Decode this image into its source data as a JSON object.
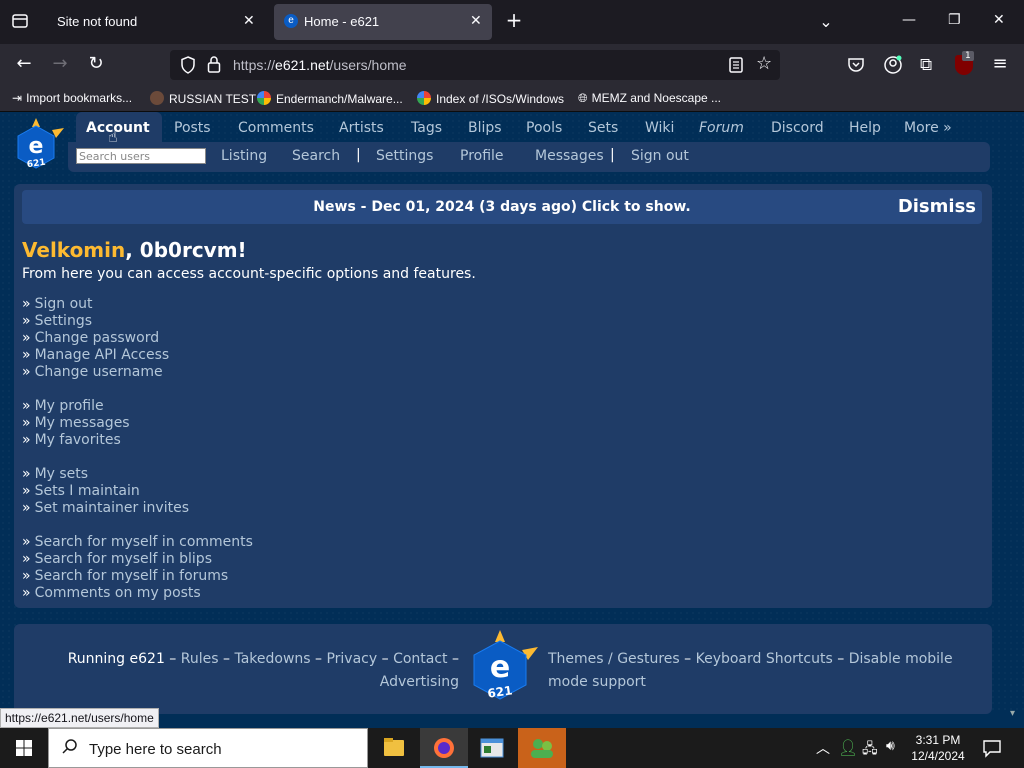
{
  "browser": {
    "tabs": [
      {
        "title": "Site not found",
        "active": false
      },
      {
        "title": "Home - e621",
        "active": true
      }
    ],
    "url": {
      "scheme": "https://",
      "host": "e621.net",
      "path": "/users/home"
    },
    "bookmarks": [
      {
        "label": "Import bookmarks...",
        "icon": "import-icon"
      },
      {
        "label": "RUSSIAN TEST",
        "icon": "russian-test-favicon"
      },
      {
        "label": "Endermanch/Malware...",
        "icon": "google-favicon"
      },
      {
        "label": "Index of /ISOs/Windows",
        "icon": "google-favicon"
      },
      {
        "label": "MEMZ and Noescape ...",
        "icon": "globe-icon"
      }
    ],
    "extension_badge": "1",
    "status_url": "https://e621.net/users/home"
  },
  "site": {
    "nav": [
      "Account",
      "Posts",
      "Comments",
      "Artists",
      "Tags",
      "Blips",
      "Pools",
      "Sets",
      "Wiki",
      "Forum",
      "Discord",
      "Help",
      "More »"
    ],
    "active_nav": "Account",
    "search_placeholder": "Search users",
    "subnav": [
      "Listing",
      "Search",
      "Settings",
      "Profile",
      "Messages",
      "Sign out"
    ],
    "news": "News - Dec 01, 2024 (3 days ago) Click to show.",
    "dismiss": "Dismiss",
    "welcome_word": "Velkomin",
    "welcome_rest": ", 0b0rcvm!",
    "intro": "From here you can access account-specific options and features.",
    "link_groups": [
      [
        "Sign out",
        "Settings",
        "Change password",
        "Manage API Access",
        "Change username"
      ],
      [
        "My profile",
        "My messages",
        "My favorites"
      ],
      [
        "My sets",
        "Sets I maintain",
        "Set maintainer invites"
      ],
      [
        "Search for myself in comments",
        "Search for myself in blips",
        "Search for myself in forums",
        "Comments on my posts"
      ]
    ],
    "footer_left": {
      "prefix": "Running e621",
      "links": [
        "Rules",
        "Takedowns",
        "Privacy",
        "Contact",
        "Advertising"
      ]
    },
    "footer_right": {
      "links": [
        "Themes / Gestures",
        "Keyboard Shortcuts",
        "Disable mobile mode support"
      ]
    },
    "logo_letter": "e",
    "logo_digits": "621"
  },
  "taskbar": {
    "search_placeholder": "Type here to search",
    "time": "3:31 PM",
    "date": "12/4/2024"
  },
  "colors": {
    "page_bg": "#012e57",
    "panel_bg": "#1f3c67",
    "link": "#b4c7d9",
    "accent_yellow": "#fdba31",
    "news_bg": "#284a81"
  }
}
